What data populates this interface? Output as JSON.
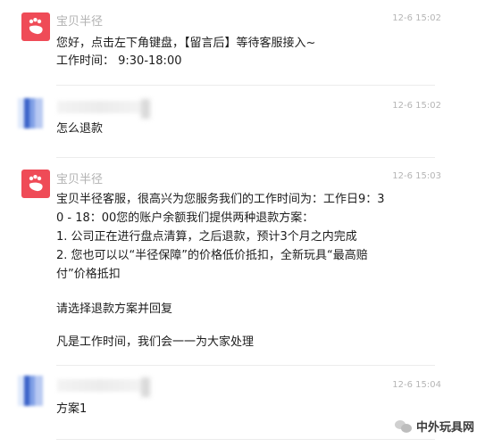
{
  "colors": {
    "brand": "#ef4b57",
    "meta_text": "#b2b2b2",
    "body_text": "#1c1c1c",
    "divider": "#ececec"
  },
  "messages": [
    {
      "sender": "宝贝半径",
      "time": "12-6 15:02",
      "avatar_icon": "footprint-icon",
      "lines": [
        "您好，点击左下角键盘，【留言后】等待客服接入~",
        "工作时间： 9:30-18:00"
      ]
    },
    {
      "sender": "",
      "time": "12-6 15:02",
      "avatar_icon": "blurred-user-avatar",
      "lines": [
        "怎么退款"
      ]
    },
    {
      "sender": "宝贝半径",
      "time": "12-6 15:03",
      "avatar_icon": "footprint-icon",
      "lines": [
        "宝贝半径客服，很高兴为您服务我们的工作时间为：工作日9：3",
        "0 - 18：00您的账户余额我们提供两种退款方案：",
        "1. 公司正在进行盘点清算，之后退款，预计3个月之内完成",
        "2. 您也可以以“半径保障”的价格低价抵扣，全新玩具“最高赔",
        "付”价格抵扣",
        "",
        "请选择退款方案并回复",
        "",
        "凡是工作时间，我们会一一为大家处理"
      ]
    },
    {
      "sender": "",
      "time": "12-6 15:04",
      "avatar_icon": "blurred-user-avatar",
      "lines": [
        "方案1"
      ]
    }
  ],
  "watermark": {
    "label": "中外玩具网",
    "icon": "wechat-logo-icon"
  }
}
